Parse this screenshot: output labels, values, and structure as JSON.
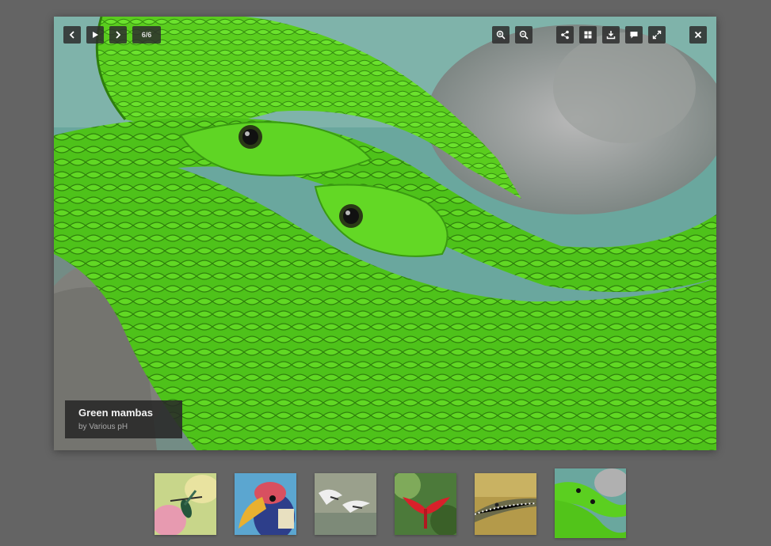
{
  "viewer": {
    "counter": "6/6",
    "caption": {
      "title": "Green mambas",
      "author": "by Various pH"
    }
  },
  "toolbar": {
    "left": [
      {
        "name": "prev-button",
        "icon": "chevron-left-icon"
      },
      {
        "name": "play-button",
        "icon": "play-icon"
      },
      {
        "name": "next-button",
        "icon": "chevron-right-icon"
      }
    ],
    "right": [
      {
        "name": "zoom-in-button",
        "icon": "zoom-in-icon"
      },
      {
        "name": "zoom-out-button",
        "icon": "zoom-out-icon"
      },
      {
        "name": "share-button",
        "icon": "share-icon"
      },
      {
        "name": "thumbnails-button",
        "icon": "grid-icon"
      },
      {
        "name": "download-button",
        "icon": "download-icon"
      },
      {
        "name": "comments-button",
        "icon": "speech-bubble-icon"
      },
      {
        "name": "fullscreen-button",
        "icon": "expand-icon"
      },
      {
        "name": "close-button",
        "icon": "close-icon"
      }
    ]
  },
  "thumbnails": [
    {
      "subject": "hummingbird",
      "active": false
    },
    {
      "subject": "hornbill",
      "active": false
    },
    {
      "subject": "birds in flight",
      "active": false
    },
    {
      "subject": "red bird",
      "active": false
    },
    {
      "subject": "crocodile",
      "active": false
    },
    {
      "subject": "green mambas",
      "active": true
    }
  ],
  "colors": {
    "background": "#646464",
    "toolbar_button": "#2d2d2d",
    "snake_green": "#4fc41c"
  }
}
